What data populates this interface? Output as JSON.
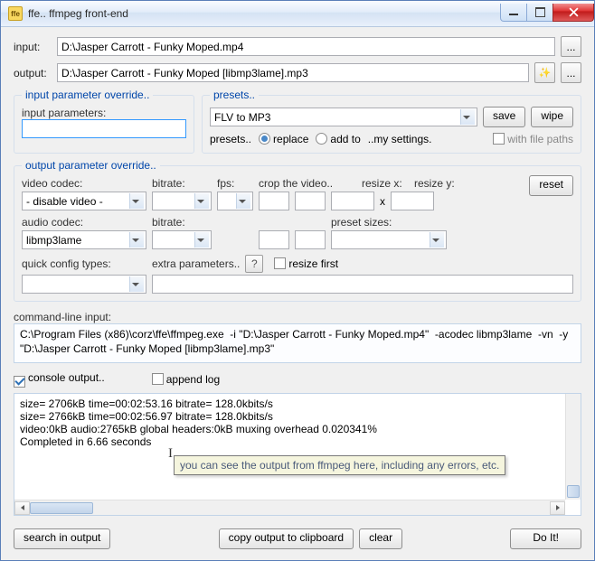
{
  "window": {
    "title": "ffe.. ffmpeg front-end",
    "icon_text": "ffe"
  },
  "paths": {
    "input_label": "input:",
    "input_value": "D:\\Jasper Carrott - Funky Moped.mp4",
    "output_label": "output:",
    "output_value": "D:\\Jasper Carrott - Funky Moped [libmp3lame].mp3"
  },
  "input_override": {
    "legend": "input parameter override..",
    "label": "input parameters:",
    "value": ""
  },
  "presets": {
    "legend": "presets..",
    "selected": "FLV to MP3",
    "save": "save",
    "wipe": "wipe",
    "row2_prefix": "presets..",
    "replace": "replace",
    "addto": "add to",
    "my_settings": "..my settings.",
    "with_paths": "with file paths"
  },
  "output_override": {
    "legend": "output parameter override..",
    "reset": "reset",
    "video_codec_label": "video codec:",
    "video_codec_value": "- disable video -",
    "bitrate_label": "bitrate:",
    "fps_label": "fps:",
    "crop_label": "crop the video..",
    "x_sep": "x",
    "resize_x": "resize x:",
    "resize_y": "resize y:",
    "audio_codec_label": "audio codec:",
    "audio_codec_value": "libmp3lame",
    "preset_sizes": "preset sizes:",
    "quick_config": "quick config types:",
    "extra_params": "extra parameters..",
    "resize_first": "resize first"
  },
  "cmdline": {
    "label": "command-line input:",
    "value": "C:\\Program Files (x86)\\corz\\ffe\\ffmpeg.exe  -i \"D:\\Jasper Carrott - Funky Moped.mp4\"  -acodec libmp3lame  -vn  -y  \"D:\\Jasper Carrott - Funky Moped [libmp3lame].mp3\""
  },
  "console": {
    "cb_label": "console output..",
    "append_label": "append log",
    "lines": [
      "size=    2706kB time=00:02:53.16 bitrate= 128.0kbits/s",
      "size=    2766kB time=00:02:56.97 bitrate= 128.0kbits/s",
      "video:0kB audio:2765kB global headers:0kB muxing overhead 0.020341%",
      "",
      "Completed in 6.66 seconds"
    ],
    "tooltip": "you can see the output from ffmpeg here, including any errors, etc."
  },
  "footer_buttons": {
    "search": "search in output",
    "copy": "copy output to clipboard",
    "clear": "clear",
    "doit": "Do It!"
  },
  "icons": {
    "browse": "...",
    "magic": "✨"
  }
}
